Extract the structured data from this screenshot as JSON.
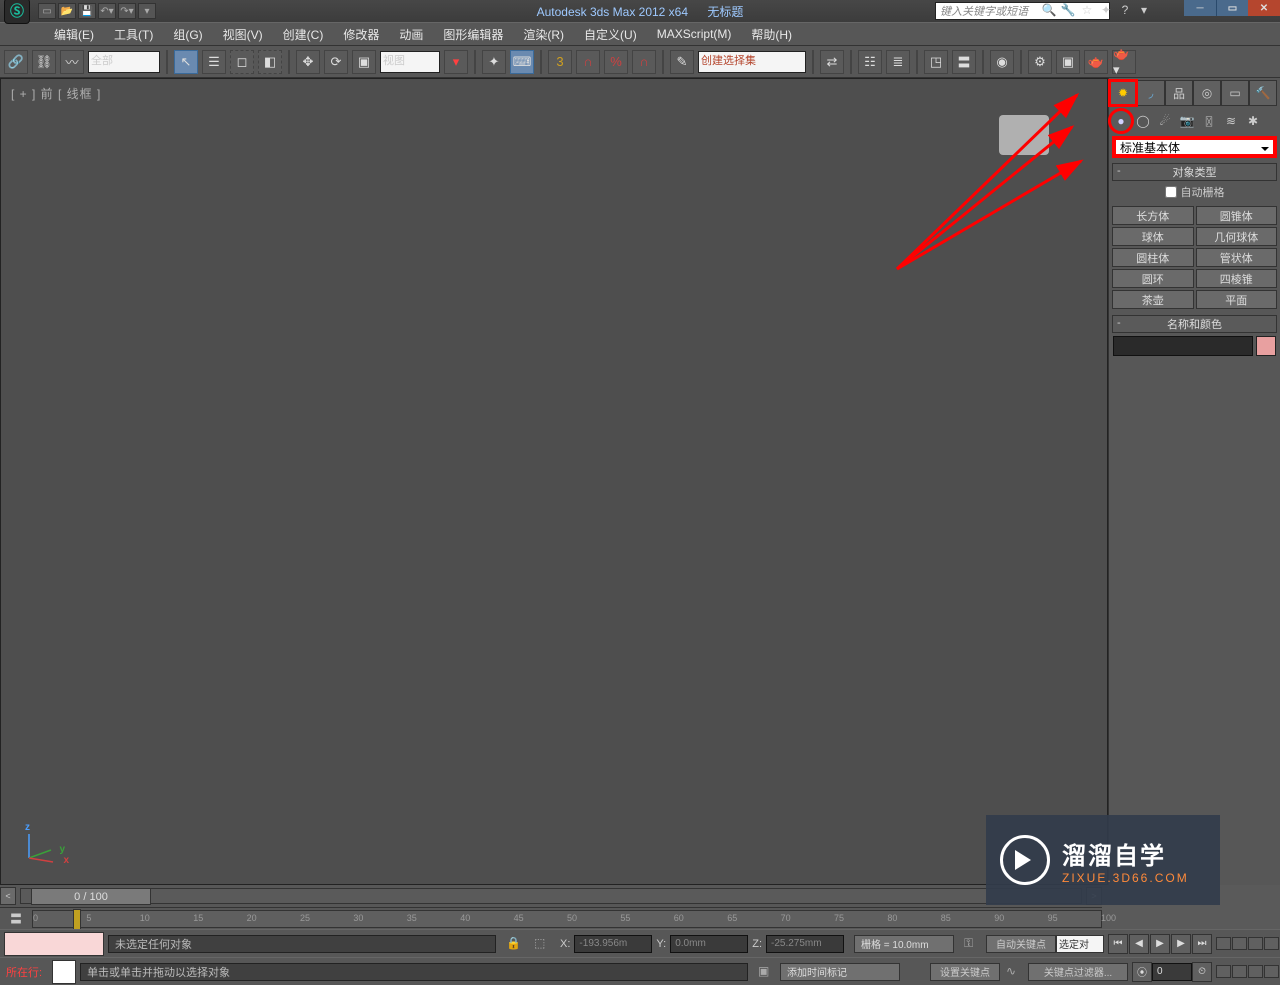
{
  "title": {
    "app": "Autodesk 3ds Max  2012 x64",
    "doc": "无标题"
  },
  "search_placeholder": "键入关键字或短语",
  "menubar": [
    "编辑(E)",
    "工具(T)",
    "组(G)",
    "视图(V)",
    "创建(C)",
    "修改器",
    "动画",
    "图形编辑器",
    "渲染(R)",
    "自定义(U)",
    "MAXScript(M)",
    "帮助(H)"
  ],
  "selection_filter": "全部",
  "view_combo": "视图",
  "selection_set": "创建选择集",
  "viewport_label": "[ + ] 前 [ 线框 ]",
  "panel": {
    "primitive_dd": "标准基本体",
    "rollout_objtype": "对象类型",
    "autogrid": "自动栅格",
    "buttons": [
      "长方体",
      "圆锥体",
      "球体",
      "几何球体",
      "圆柱体",
      "管状体",
      "圆环",
      "四棱锥",
      "茶壶",
      "平面"
    ],
    "rollout_namecolor": "名称和颜色"
  },
  "timeslider": "0 / 100",
  "timeslider_ticks": [
    "0",
    "5",
    "10",
    "15",
    "20",
    "25",
    "30",
    "35",
    "40",
    "45",
    "50",
    "55",
    "60",
    "65",
    "70",
    "75",
    "80",
    "85",
    "90",
    "95",
    "100"
  ],
  "status": {
    "no_sel": "未选定任何对象",
    "prompt": "单击或单击并拖动以选择对象",
    "script_label": "所在行:",
    "x_label": "X:",
    "x_val": "-193.956m",
    "y_label": "Y:",
    "y_val": "0.0mm",
    "z_label": "Z:",
    "z_val": "-25.275mm",
    "grid": "栅格 = 10.0mm",
    "autokey": "自动关键点",
    "setkey": "设置关键点",
    "selset_dd": "选定对",
    "keyfilter": "关键点过滤器...",
    "addtime": "添加时间标记",
    "frame": "0"
  },
  "watermark": {
    "main": "溜溜自学",
    "sub": "ZIXUE.3D66.COM"
  },
  "qat_icons": [
    "new",
    "open",
    "save",
    "undo-dd",
    "redo-dd",
    "link-dd"
  ],
  "help_icons": [
    "cube",
    "wrench",
    "star",
    "star2",
    "help-circle",
    "dd"
  ],
  "win": [
    "min",
    "max",
    "close"
  ],
  "cmd_tabs": [
    "create",
    "modify",
    "hierarchy",
    "motion",
    "display",
    "utilities"
  ],
  "sub_tabs": [
    "geometry",
    "shapes",
    "lights",
    "cameras",
    "helpers",
    "spacewarps",
    "systems"
  ],
  "toolbar_icons": [
    "link",
    "unlink",
    "bind-spacewarp",
    "sel-filter",
    "select",
    "sel-rect",
    "sel-window",
    "sel-crossing",
    "move",
    "rotate",
    "scale",
    "refcoord",
    "pivot",
    "sel-center",
    "manip",
    "snap3",
    "snap-a",
    "snap-p",
    "snap-s",
    "sel-lock",
    "named-sel",
    "mirror-set",
    "mirror",
    "align",
    "layers",
    "curve-ed",
    "schematic",
    "mat-ed",
    "render-setup",
    "rendered-frame",
    "render",
    "teapot",
    "teapot-dd"
  ]
}
